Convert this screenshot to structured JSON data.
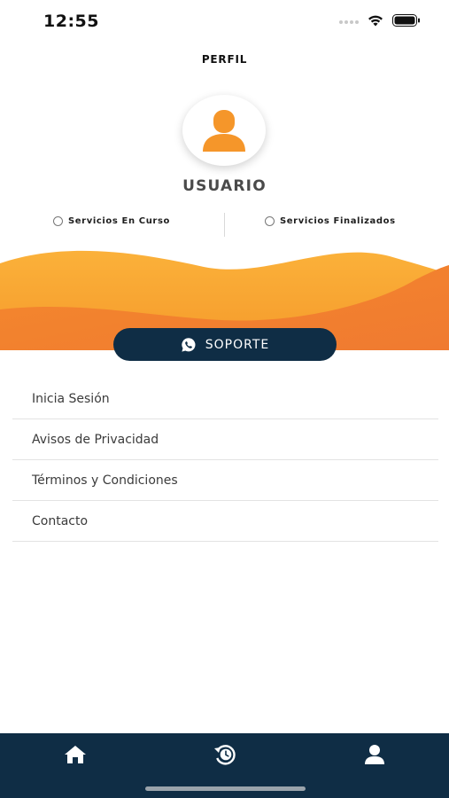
{
  "status_bar": {
    "time": "12:55",
    "wifi_icon": "wifi-icon",
    "battery_icon": "battery-icon"
  },
  "header": {
    "title": "PERFIL"
  },
  "profile": {
    "avatar_icon": "user-icon",
    "name": "USUARIO",
    "accent_color": "#f5962a"
  },
  "filters": [
    {
      "label": "Servicios En Curso"
    },
    {
      "label": "Servicios Finalizados"
    }
  ],
  "support": {
    "label": "SOPORTE",
    "icon": "whatsapp-icon"
  },
  "menu": {
    "items": [
      {
        "label": "Inicia Sesión"
      },
      {
        "label": "Avisos de Privacidad"
      },
      {
        "label": "Términos y Condiciones"
      },
      {
        "label": "Contacto"
      }
    ]
  },
  "bottom_nav": {
    "items": [
      {
        "icon": "home-icon"
      },
      {
        "icon": "history-icon"
      },
      {
        "icon": "profile-icon"
      }
    ],
    "background": "#0f2d45"
  }
}
